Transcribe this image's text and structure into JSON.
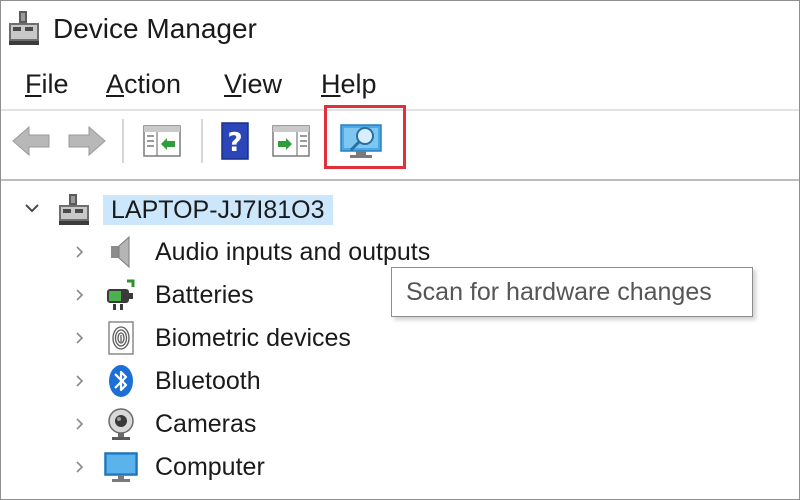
{
  "window": {
    "title": "Device Manager"
  },
  "menu": {
    "items": [
      {
        "accel": "F",
        "rest": "ile"
      },
      {
        "accel": "A",
        "rest": "ction"
      },
      {
        "accel": "V",
        "rest": "iew"
      },
      {
        "accel": "H",
        "rest": "elp"
      }
    ]
  },
  "toolbar": {
    "buttons": [
      "back-arrow-icon",
      "forward-arrow-icon",
      "show-hide-console-tree-icon",
      "help-icon",
      "show-hide-action-pane-icon",
      "scan-hardware-icon"
    ],
    "highlight_color": "#e0303a"
  },
  "tree": {
    "root": {
      "label": "LAPTOP-JJ7I81O3",
      "icon": "computer-network-icon"
    },
    "nodes": [
      {
        "label": "Audio inputs and outputs",
        "icon": "speaker-icon"
      },
      {
        "label": "Batteries",
        "icon": "battery-icon"
      },
      {
        "label": "Biometric devices",
        "icon": "fingerprint-icon"
      },
      {
        "label": "Bluetooth",
        "icon": "bluetooth-icon"
      },
      {
        "label": "Cameras",
        "icon": "webcam-icon"
      },
      {
        "label": "Computer",
        "icon": "monitor-icon"
      }
    ]
  },
  "tooltip": {
    "text": "Scan for hardware changes"
  },
  "colors": {
    "selection": "#cce6fb",
    "accent": "#0078d7"
  }
}
